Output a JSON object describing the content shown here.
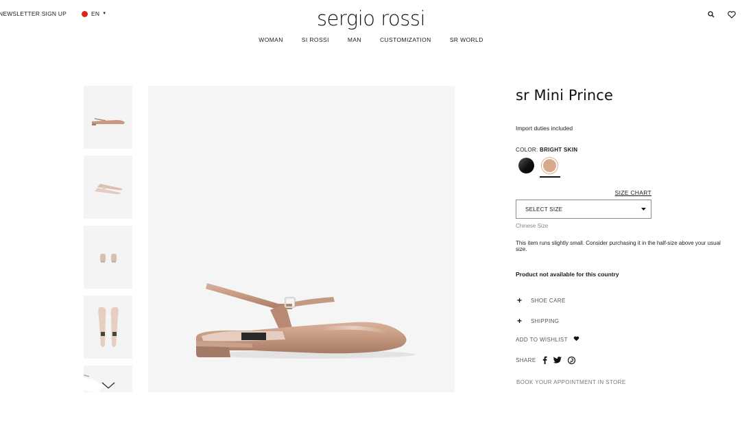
{
  "header": {
    "newsletter_label": "NEWSLETTER SIGN UP",
    "language": "EN",
    "logo": "sergio rossi",
    "search_icon": "search-icon",
    "wishlist_icon": "heart-icon"
  },
  "nav": {
    "items": [
      "WOMAN",
      "SI ROSSI",
      "MAN",
      "CUSTOMIZATION",
      "SR WORLD"
    ]
  },
  "gallery": {
    "thumbnails": [
      "side-view",
      "pair-top-view",
      "back-view",
      "top-down-view",
      "detail-view"
    ],
    "scroll_icon": "chevron-down-icon"
  },
  "product": {
    "title": "sr Mini Prince",
    "duties": "Import duties included",
    "color_label": "COLOR:",
    "color_value": "BRIGHT SKIN",
    "colors": [
      {
        "name": "black",
        "hex": "#111111",
        "selected": false
      },
      {
        "name": "bright skin",
        "hex": "#d7a98d",
        "selected": true
      }
    ],
    "size_chart": "SIZE CHART",
    "size_select": "SELECT SIZE",
    "size_note": "Chinese Size",
    "fit_note": "This item runs slightly small. Consider purchasing it in the half-size above your usual size.",
    "availability": "Product not available for this country",
    "accordion": [
      "SHOE CARE",
      "SHIPPING"
    ],
    "wishlist": "ADD TO WISHLIST",
    "share": "SHARE",
    "appointment": "BOOK YOUR APPOINTMENT IN STORE"
  }
}
